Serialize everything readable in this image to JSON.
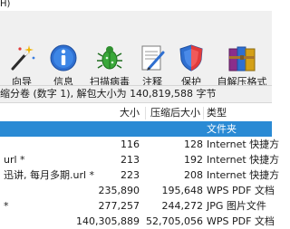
{
  "menubar": {
    "partial_label": "H)"
  },
  "toolbar": {
    "buttons": [
      {
        "label": "向导",
        "icon": "wizard-icon"
      },
      {
        "label": "信息",
        "icon": "info-icon"
      },
      {
        "label": "扫描病毒",
        "icon": "bug-icon"
      },
      {
        "label": "注释",
        "icon": "comment-icon"
      },
      {
        "label": "保护",
        "icon": "shield-icon"
      },
      {
        "label": "自解压格式",
        "icon": "books-icon"
      }
    ]
  },
  "status": {
    "text": "缩分卷 (数字 1), 解包大小为 140,819,588 字节"
  },
  "columns": {
    "size": "大小",
    "packed": "压缩后大小",
    "type": "类型"
  },
  "rows": [
    {
      "name": "",
      "size": "",
      "packed": "",
      "type": "文件夹",
      "selected": true
    },
    {
      "name": "",
      "size": "116",
      "packed": "128",
      "type": "Internet 快捷方"
    },
    {
      "name": "url *",
      "size": "213",
      "packed": "192",
      "type": "Internet 快捷方"
    },
    {
      "name": "迅讲, 每月多期.url *",
      "size": "223",
      "packed": "208",
      "type": "Internet 快捷方"
    },
    {
      "name": "",
      "size": "235,890",
      "packed": "195,648",
      "type": "WPS PDF 文档"
    },
    {
      "name": "*",
      "size": "277,257",
      "packed": "244,272",
      "type": "JPG 图片文件"
    },
    {
      "name": "",
      "size": "140,305,889",
      "packed": "52,705,056",
      "type": "WPS PDF 文档"
    }
  ],
  "colors": {
    "selection": "#2a8ad4",
    "toolbar_bg": "#f0f0f0"
  }
}
